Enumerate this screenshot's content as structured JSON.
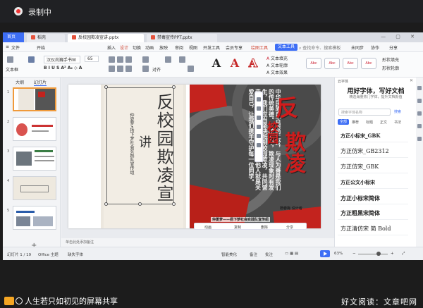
{
  "recording": {
    "label": "录制中"
  },
  "tabs": [
    {
      "label": "首页"
    },
    {
      "label": "稻壳"
    },
    {
      "label": "反校园欺凌宣讲.pptx"
    },
    {
      "label": "禁毒宣传PPT.pptx"
    }
  ],
  "menus": [
    "文件",
    "开始",
    "插入",
    "设计",
    "切换",
    "动画",
    "放映",
    "审阅",
    "视图",
    "开发工具",
    "会员专享",
    "绘图工具",
    "文本工具"
  ],
  "menu_extra": {
    "search": "查找命令、搜索模板",
    "cloud": "未同步",
    "collab": "协作",
    "share": "分享"
  },
  "ribbon": {
    "textbox": "文本框",
    "font": "汉仪尚巍手书W",
    "size": "65",
    "arrange": "对齐",
    "text_fill": "文本填充",
    "text_outline": "文本轮廓",
    "text_effect": "文本效果",
    "shape_fill": "形状填充",
    "shape_outline": "形状轮廓",
    "style_a": "A"
  },
  "left_pane": {
    "tab_outline": "大纲",
    "tab_slides": "幻灯片",
    "numbers": [
      "1",
      "2",
      "3",
      "4",
      "5"
    ]
  },
  "slide": {
    "title": "反校园欺凌宣",
    "jiang": "讲",
    "subtitle": "仲夏梦•扬下梦社会实践队宣传组",
    "poster_body": "中华民族自古崇尚仁爱，与人为善是我们的传统美德。在校园中，欺凌现象时有发生，我们应当坚决抵制校园欺凌，共同营造和谐友爱的校园环境。关爱他人就是关爱自己，让我们携手守护每一位同学。",
    "poster_big1": "反",
    "poster_big2": "校园",
    "poster_big3": "欺凌",
    "credit_left": "仲夏梦——扬下梦社会实践队宣传组",
    "credit_right": "杨春梅 设计者"
  },
  "bottom_toolbar": [
    "动画",
    "复制",
    "删除",
    "分享"
  ],
  "notes": "单击此处添加备注",
  "right_pane": {
    "header": "云字体",
    "title": "用好字体，写好文档",
    "subtitle": "精选海量热门字体，提升文档颜值",
    "search_placeholder": "搜索字体名称",
    "search_btn": "搜索",
    "tabs": [
      "全部",
      "推荐",
      "标题",
      "正文",
      "书法"
    ],
    "fonts": [
      "方正小标宋_GBK",
      "方正仿宋_GB2312",
      "方正仿宋_GBK",
      "方正公文小标宋",
      "方正小标宋简体",
      "方正粗黑宋简体",
      "方正清仿宋 简 Bold"
    ]
  },
  "statusbar": {
    "slide_pos": "幻灯片 1 / 19",
    "theme": "Office 主题",
    "missing_font": "缺失字体",
    "smart_beautify": "智能美化",
    "notes_btn": "备注",
    "comments_btn": "批注",
    "zoom": "63%"
  },
  "share_overlay": {
    "text": "人生若只如初见的屏幕共享"
  },
  "watermark": "好文阅读：文章吧网"
}
